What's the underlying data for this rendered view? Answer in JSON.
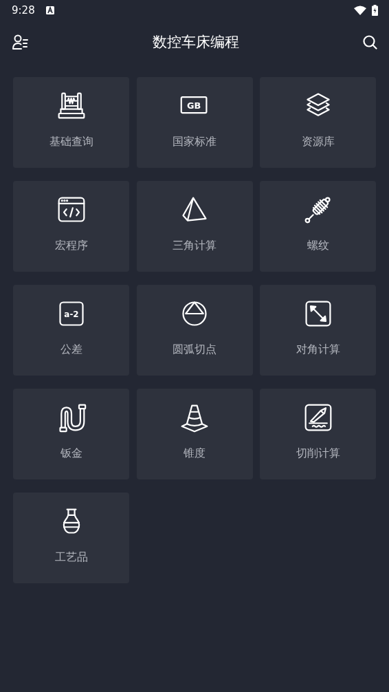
{
  "status_bar": {
    "time": "9:28"
  },
  "app_bar": {
    "title": "数控车床编程"
  },
  "items": [
    {
      "label": "基础查询",
      "kind": "abacus"
    },
    {
      "label": "国家标准",
      "kind": "tag",
      "icon_text": "GB"
    },
    {
      "label": "资源库",
      "kind": "layers"
    },
    {
      "label": "宏程序",
      "kind": "code"
    },
    {
      "label": "三角计算",
      "kind": "pyramid"
    },
    {
      "label": "螺纹",
      "kind": "spring"
    },
    {
      "label": "公差",
      "kind": "square",
      "icon_text": "a-2"
    },
    {
      "label": "圆弧切点",
      "kind": "circle"
    },
    {
      "label": "对角计算",
      "kind": "diagonal"
    },
    {
      "label": "钣金",
      "kind": "pipe"
    },
    {
      "label": "锥度",
      "kind": "cone"
    },
    {
      "label": "切削计算",
      "kind": "pen"
    },
    {
      "label": "工艺品",
      "kind": "vase"
    }
  ]
}
